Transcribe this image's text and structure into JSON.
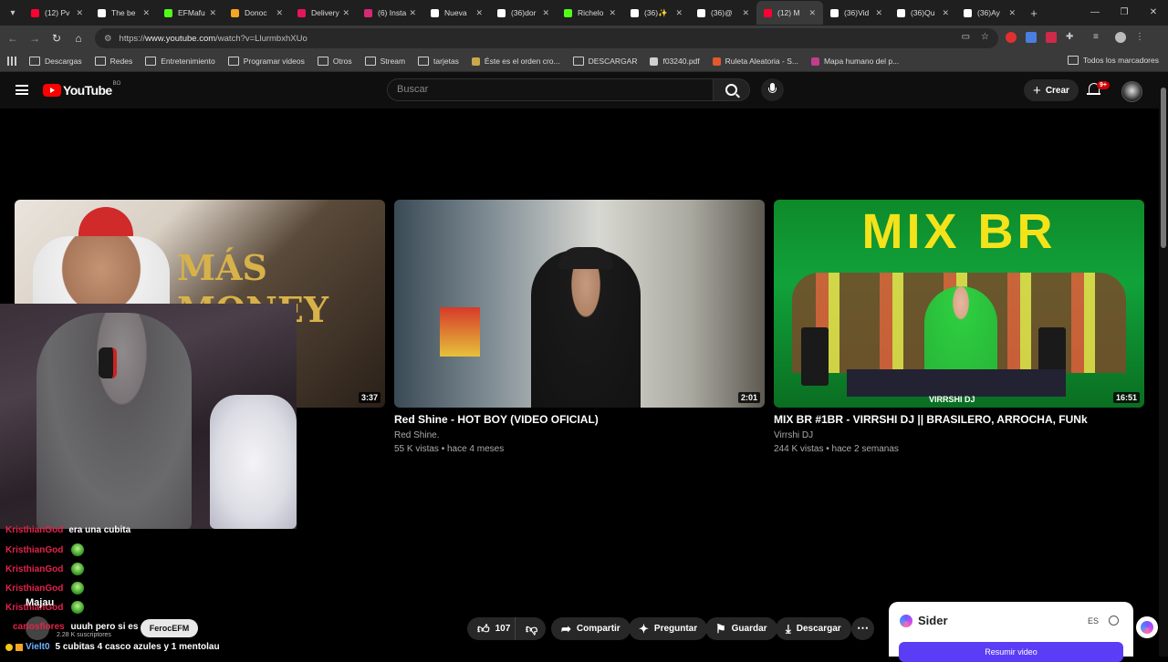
{
  "browser": {
    "tabs": [
      {
        "label": "(12) Pv",
        "color": "#ff0033"
      },
      {
        "label": "The be",
        "color": "#ffffff"
      },
      {
        "label": "EFMafu",
        "color": "#53fc18"
      },
      {
        "label": "Donoc",
        "color": "#f5a623"
      },
      {
        "label": "Delivery",
        "color": "#e4165a"
      },
      {
        "label": "(6) Insta",
        "color": "#d62976"
      },
      {
        "label": "Nueva",
        "color": "#ffffff"
      },
      {
        "label": "(36)dor",
        "color": "#ffffff"
      },
      {
        "label": "Richelo",
        "color": "#53fc18"
      },
      {
        "label": "(36)✨",
        "color": "#ffffff"
      },
      {
        "label": "(36)@",
        "color": "#ffffff"
      },
      {
        "label": "(12) M",
        "color": "#ff0033"
      },
      {
        "label": "(36)Vid",
        "color": "#ffffff"
      },
      {
        "label": "(36)Qu",
        "color": "#ffffff"
      },
      {
        "label": "(36)Ay",
        "color": "#ffffff"
      }
    ],
    "active_tab_index": 11,
    "url_prefix": "https://",
    "url_host": "www.youtube.com",
    "url_path": "/watch?v=LlurmbxhXUo",
    "bookmarks": [
      {
        "label": "Descargas",
        "type": "folder"
      },
      {
        "label": "Redes",
        "type": "folder"
      },
      {
        "label": "Entretenimiento",
        "type": "folder"
      },
      {
        "label": "Programar videos",
        "type": "folder"
      },
      {
        "label": "Otros",
        "type": "folder"
      },
      {
        "label": "Stream",
        "type": "folder"
      },
      {
        "label": "tarjetas",
        "type": "folder"
      },
      {
        "label": "Éste es el orden cro...",
        "type": "link",
        "color": "#c8a84b"
      },
      {
        "label": "DESCARGAR",
        "type": "folder"
      },
      {
        "label": "f03240.pdf",
        "type": "link",
        "color": "#d0d0d0"
      },
      {
        "label": "Ruleta Aleatoria - S...",
        "type": "link",
        "color": "#e05a2b"
      },
      {
        "label": "Mapa humano del p...",
        "type": "link",
        "color": "#c43c8e"
      }
    ],
    "bookmarks_all": "Todos los marcadores"
  },
  "youtube": {
    "logo": "YouTube",
    "country_code": "BO",
    "search_placeholder": "Buscar",
    "create_label": "Crear",
    "notif_badge": "9+"
  },
  "videos": [
    {
      "title": "",
      "channel": "",
      "meta": "",
      "duration": "3:37",
      "thumb_text": "MÁS MONEY MÁS CASH"
    },
    {
      "title": "Red Shine - HOT BOY (VIDEO OFICIAL)",
      "channel": "Red Shine.",
      "meta": "55 K vistas • hace 4 meses",
      "duration": "2:01"
    },
    {
      "title": "MIX BR #1BR - VIRRSHI DJ || BRASILERO, ARROCHA, FUNk",
      "channel": "Virrshi DJ",
      "meta": "244 K vistas • hace 2 semanas",
      "duration": "16:51",
      "thumb_text": "MIX BR",
      "thumb_sub": "VIRRSHI DJ"
    }
  ],
  "chat": [
    {
      "user": "KristhianGod",
      "message": "era una cubita"
    },
    {
      "user": "KristhianGod",
      "message": ""
    },
    {
      "user": "KristhianGod",
      "message": ""
    },
    {
      "user": "KristhianGod",
      "message": ""
    },
    {
      "user": "KristhianGod",
      "message": ""
    }
  ],
  "overlay": {
    "channel_name": "Majau",
    "subscribers": "2.28 K suscriptores",
    "chat_user": "carlosflores",
    "chat_text": "uuuh pero si es",
    "chat_pill": "FerocEFM",
    "last_user": "Vielt0",
    "last_message": "5 cubitas 4 casco azules y 1 mentolau"
  },
  "actions": {
    "likes": "107",
    "share": "Compartir",
    "ask": "Preguntar",
    "save": "Guardar",
    "download": "Descargar"
  },
  "sider": {
    "name": "Sider",
    "lang": "ES",
    "summary_button": "Resumir video"
  }
}
